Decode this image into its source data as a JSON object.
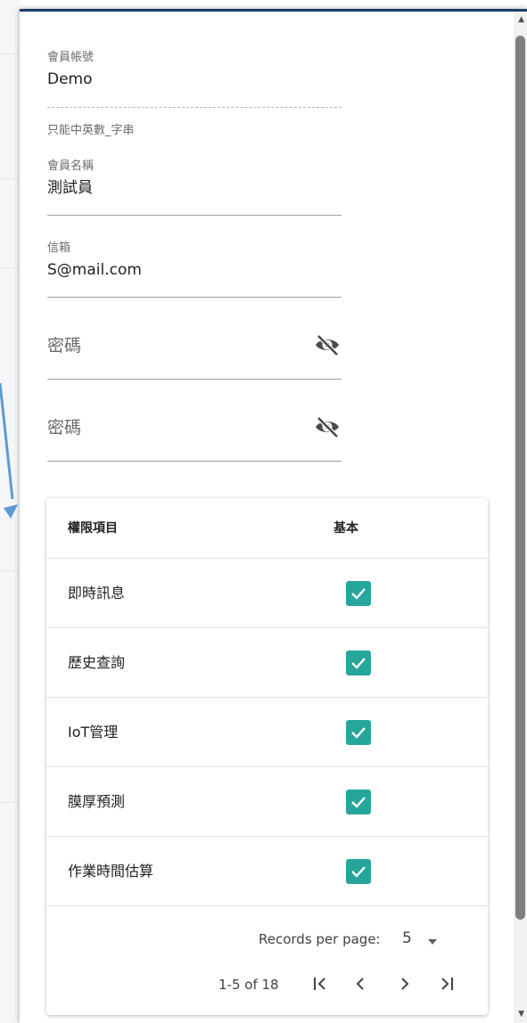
{
  "form": {
    "account": {
      "label": "會員帳號",
      "value": "Demo",
      "hint": "只能中英數_字串"
    },
    "name": {
      "label": "會員名稱",
      "value": "測試員"
    },
    "email": {
      "label": "信箱",
      "value": "S@mail.com"
    },
    "password": {
      "placeholder": "密碼",
      "icon": "eye-off-icon"
    },
    "password_confirm": {
      "placeholder": "密碼",
      "icon": "eye-off-icon"
    }
  },
  "permissions": {
    "header": {
      "item": "權限項目",
      "basic": "基本"
    },
    "rows": [
      {
        "name": "即時訊息",
        "basic": true
      },
      {
        "name": "歷史查詢",
        "basic": true
      },
      {
        "name": "IoT管理",
        "basic": true
      },
      {
        "name": "膜厚預測",
        "basic": true
      },
      {
        "name": "作業時間估算",
        "basic": true
      }
    ],
    "pagination": {
      "records_per_page_label": "Records per page:",
      "records_per_page_value": "5",
      "range": "1-5 of 18"
    }
  },
  "colors": {
    "accent": "#26a69a",
    "header_bar": "#1b3d6b",
    "annotation_arrow": "#5b9bd5"
  }
}
